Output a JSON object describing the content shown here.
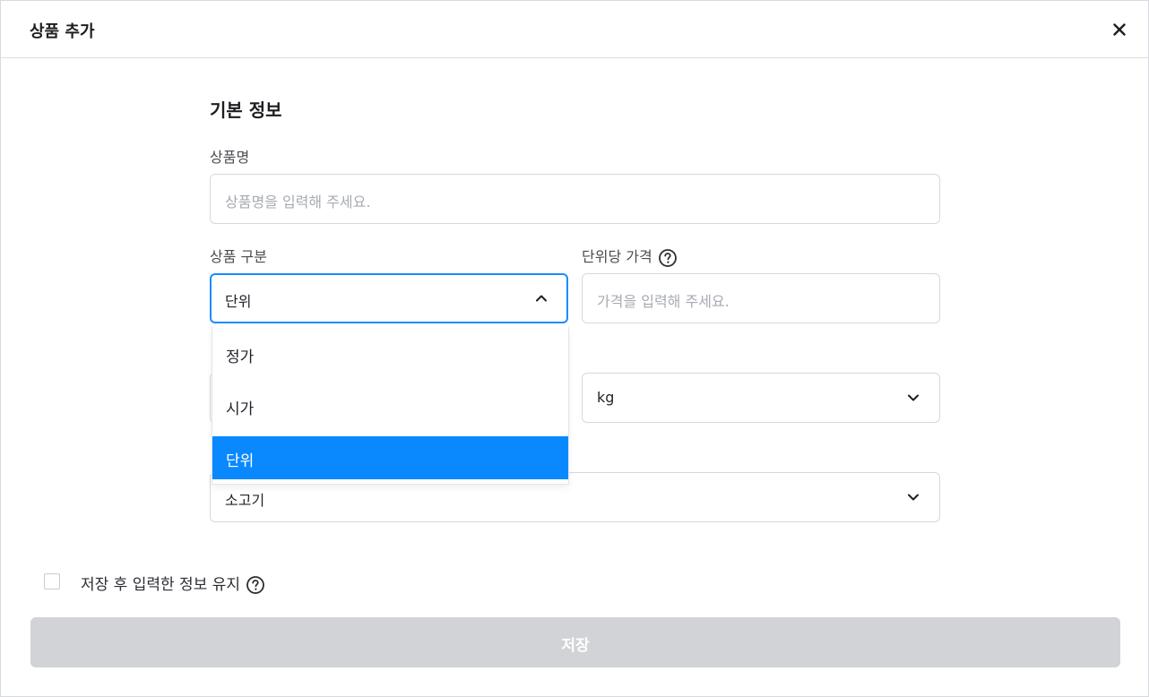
{
  "dialog": {
    "title": "상품 추가",
    "close_icon": "close-icon"
  },
  "section": {
    "title": "기본 정보"
  },
  "product_name": {
    "label": "상품명",
    "placeholder": "상품명을 입력해 주세요."
  },
  "product_type": {
    "label": "상품 구분",
    "value": "단위",
    "expanded": true,
    "options": [
      "정가",
      "시가",
      "단위"
    ],
    "selected_option": "단위"
  },
  "unit_price": {
    "label": "단위당 가격",
    "placeholder": "가격을 입력해 주세요.",
    "help_icon": "help-icon"
  },
  "unit": {
    "value": "kg"
  },
  "category": {
    "value": "소고기"
  },
  "keep_info": {
    "label": "저장 후 입력한 정보 유지",
    "checked": false,
    "help_icon": "help-icon"
  },
  "save_button": {
    "label": "저장",
    "disabled": true
  },
  "colors": {
    "accent": "#0a89ff",
    "focus_border": "#1a8cff",
    "disabled_button": "#d1d3d7",
    "placeholder": "#a7abb2"
  }
}
